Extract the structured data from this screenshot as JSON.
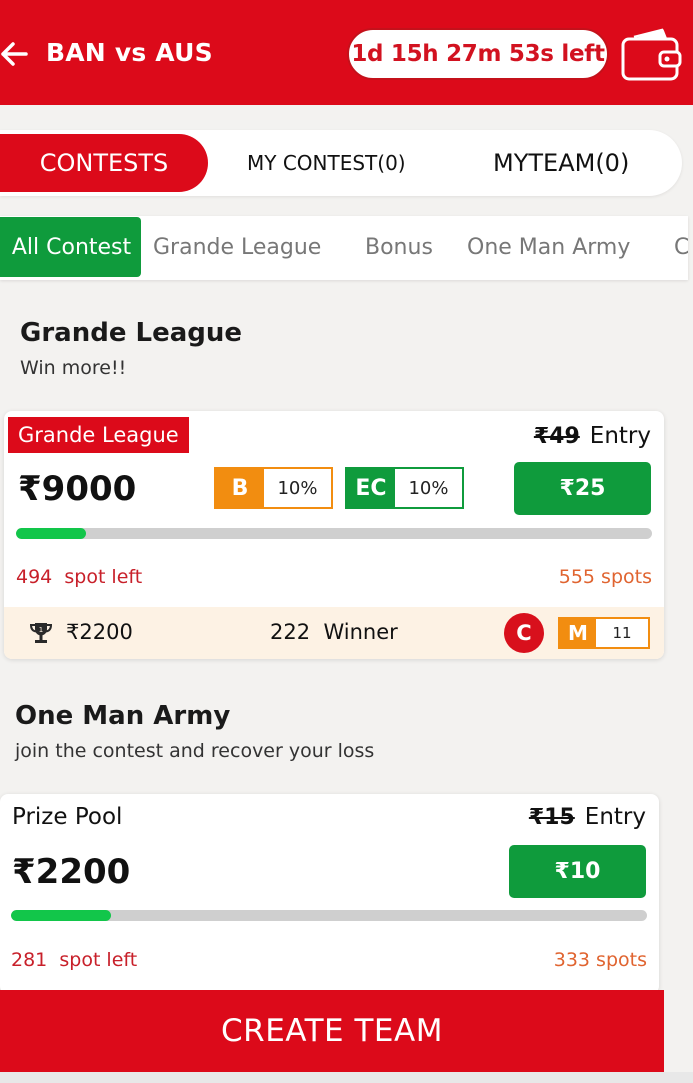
{
  "header": {
    "match_title": "BAN vs AUS",
    "timer": "1d 15h 27m 53s left",
    "back_icon": "arrow-left-icon",
    "wallet_icon": "wallet-icon"
  },
  "tabs": [
    {
      "label": "CONTESTS",
      "active": true
    },
    {
      "label": "MY CONTEST(0)",
      "active": false
    },
    {
      "label": "MYTEAM(0)",
      "active": false
    }
  ],
  "filters": [
    {
      "label": "All Contest",
      "active": true
    },
    {
      "label": "Grande League",
      "active": false
    },
    {
      "label": "Bonus",
      "active": false
    },
    {
      "label": "One Man Army",
      "active": false
    },
    {
      "label": "C",
      "active": false
    }
  ],
  "sections": [
    {
      "title": "Grande League",
      "subtitle": "Win more!!",
      "card": {
        "tag": "Grande League",
        "entry_old": "₹49",
        "entry_label": "Entry",
        "prize": "₹9000",
        "bonus_badge": {
          "key": "B",
          "value": "10%"
        },
        "ec_badge": {
          "key": "EC",
          "value": "10%"
        },
        "join_price": "₹25",
        "fill_fraction": 0.11,
        "spots_left_count": "494",
        "spots_left_label": "spot left",
        "spots_total": "555 spots",
        "footer": {
          "first_prize": "₹2200",
          "winners_count": "222",
          "winners_label": "Winner",
          "c_badge": "C",
          "m_badge_key": "M",
          "m_badge_value": "11"
        }
      }
    },
    {
      "title": "One Man Army",
      "subtitle": "join the contest and recover your loss",
      "card": {
        "label": "Prize Pool",
        "entry_old": "₹15",
        "entry_label": "Entry",
        "prize": "₹2200",
        "join_price": "₹10",
        "fill_fraction": 0.157,
        "spots_left_count": "281",
        "spots_left_label": "spot left",
        "spots_total": "333 spots"
      }
    }
  ],
  "create_button": "CREATE TEAM",
  "colors": {
    "brand_red": "#dc0a1a",
    "join_green": "#0f9b3c",
    "progress_green": "#12c64a",
    "bonus_orange": "#f28d10"
  }
}
